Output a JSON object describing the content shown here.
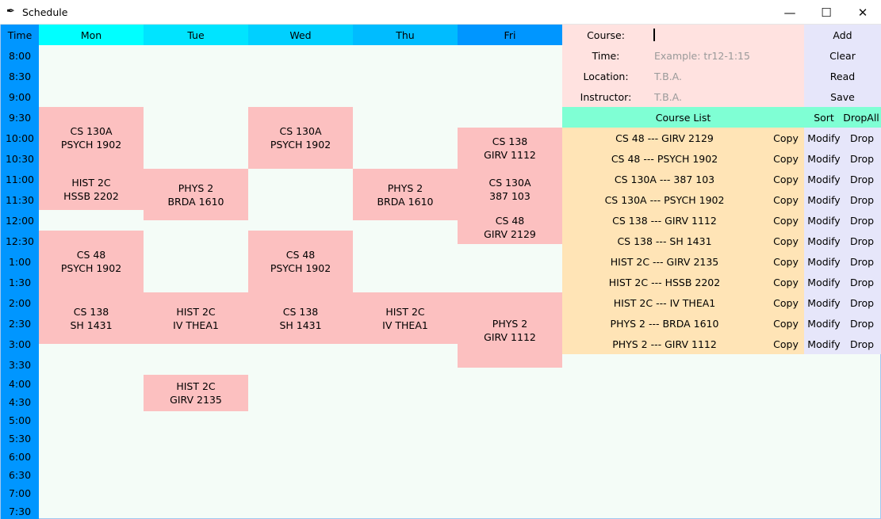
{
  "window": {
    "title": "Schedule",
    "icon": "feather-icon",
    "minimize": "—",
    "maximize": "☐",
    "close": "✕"
  },
  "grid": {
    "time_header": "Time",
    "days": [
      "Mon",
      "Tue",
      "Wed",
      "Thu",
      "Fri"
    ],
    "day_colors": [
      "#00ffff",
      "#00e4ff",
      "#00d0ff",
      "#00bcff",
      "#0096ff"
    ],
    "times": [
      "8:00",
      "8:30",
      "9:00",
      "9:30",
      "10:00",
      "10:30",
      "11:00",
      "11:30",
      "12:00",
      "12:30",
      "1:00",
      "1:30",
      "2:00",
      "2:30",
      "3:00",
      "3:30",
      "4:00",
      "4:30",
      "5:00",
      "5:30",
      "6:00",
      "6:30",
      "7:00",
      "7:30"
    ]
  },
  "blocks": [
    {
      "day": "Mon",
      "start": "9:30",
      "end": "11:00",
      "text": "CS 130A\nPSYCH 1902"
    },
    {
      "day": "Mon",
      "start": "11:00",
      "end": "12:00",
      "text": "HIST 2C\nHSSB 2202"
    },
    {
      "day": "Mon",
      "start": "12:30",
      "end": "2:00",
      "text": "CS 48\nPSYCH 1902"
    },
    {
      "day": "Mon",
      "start": "2:00",
      "end": "3:15",
      "text": "CS 138\nSH 1431"
    },
    {
      "day": "Tue",
      "start": "11:00",
      "end": "12:15",
      "text": "PHYS 2\nBRDA 1610"
    },
    {
      "day": "Tue",
      "start": "2:00",
      "end": "3:15",
      "text": "HIST 2C\nIV THEA1"
    },
    {
      "day": "Tue",
      "start": "4:00",
      "end": "5:00",
      "text": "HIST 2C\nGIRV 2135"
    },
    {
      "day": "Wed",
      "start": "9:30",
      "end": "11:00",
      "text": "CS 130A\nPSYCH 1902"
    },
    {
      "day": "Wed",
      "start": "12:30",
      "end": "2:00",
      "text": "CS 48\nPSYCH 1902"
    },
    {
      "day": "Wed",
      "start": "2:00",
      "end": "3:15",
      "text": "CS 138\nSH 1431"
    },
    {
      "day": "Thu",
      "start": "11:00",
      "end": "12:15",
      "text": "PHYS 2\nBRDA 1610"
    },
    {
      "day": "Thu",
      "start": "2:00",
      "end": "3:15",
      "text": "HIST 2C\nIV THEA1"
    },
    {
      "day": "Fri",
      "start": "10:00",
      "end": "11:00",
      "text": "CS 138\nGIRV 1112"
    },
    {
      "day": "Fri",
      "start": "11:00",
      "end": "12:00",
      "text": "CS 130A\n387 103"
    },
    {
      "day": "Fri",
      "start": "12:00",
      "end": "12:50",
      "text": "CS 48\nGIRV 2129"
    },
    {
      "day": "Fri",
      "start": "2:00",
      "end": "3:50",
      "text": "PHYS 2\nGIRV 1112"
    }
  ],
  "form": {
    "course_label": "Course:",
    "course_value": "",
    "time_label": "Time:",
    "time_placeholder": "Example: tr12-1:15",
    "location_label": "Location:",
    "location_placeholder": "T.B.A.",
    "instructor_label": "Instructor:",
    "instructor_placeholder": "T.B.A."
  },
  "buttons": {
    "add": "Add",
    "clear": "Clear",
    "read": "Read",
    "save": "Save"
  },
  "course_list": {
    "title": "Course List",
    "sort": "Sort",
    "drop_all": "DropAll",
    "copy_label": "Copy",
    "modify_label": "Modify",
    "drop_label": "Drop",
    "items": [
      "CS 48 --- GIRV 2129",
      "CS 48 --- PSYCH 1902",
      "CS 130A --- 387 103",
      "CS 130A --- PSYCH 1902",
      "CS 138 --- GIRV 1112",
      "CS 138 --- SH 1431",
      "HIST 2C --- GIRV 2135",
      "HIST 2C --- HSSB 2202",
      "HIST 2C --- IV THEA1",
      "PHYS 2 --- BRDA 1610",
      "PHYS 2 --- GIRV 1112"
    ]
  },
  "colors": {
    "time_column": "#0096ff",
    "grid_background": "#f4fcf7",
    "course_block": "#fcc0c0",
    "form_background": "#ffe2e0",
    "button_background": "#e6e6fa",
    "list_header": "#7fffd4",
    "list_background": "#ffe4b6"
  }
}
